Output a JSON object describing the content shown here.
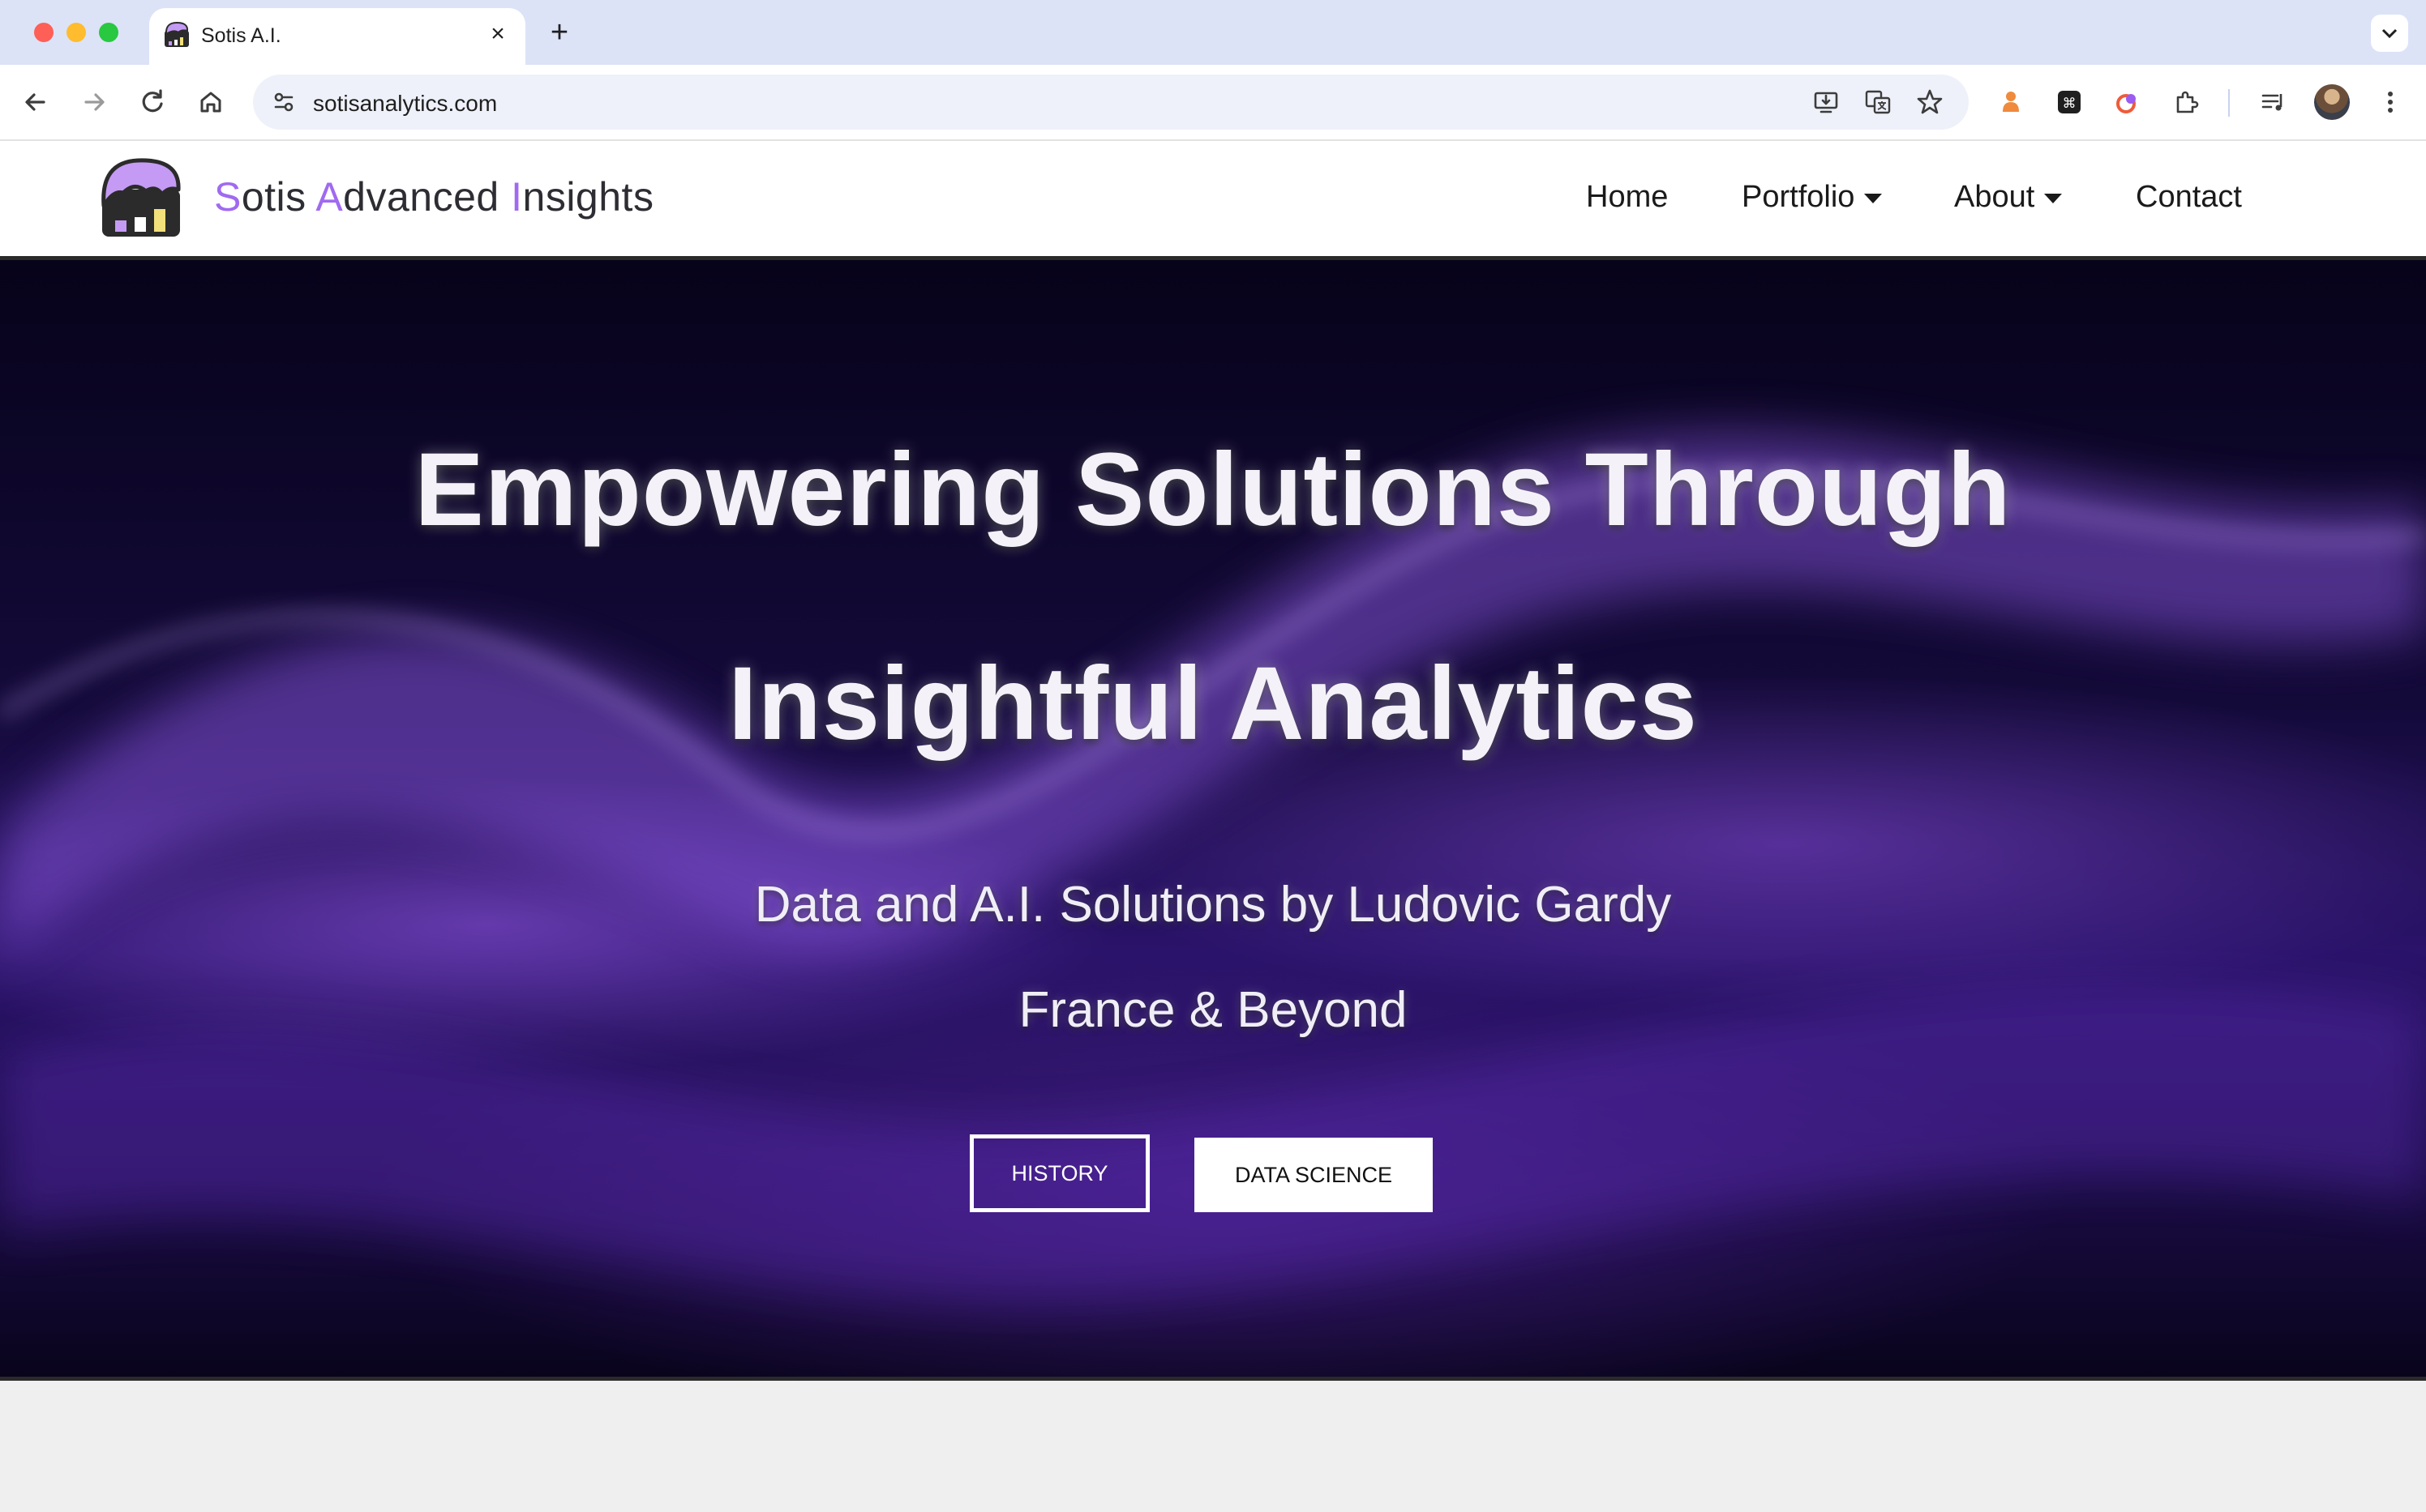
{
  "browser": {
    "tab": {
      "title": "Sotis A.I.",
      "favicon": "site-logo-icon"
    },
    "new_tab_symbol": "+",
    "close_symbol": "×",
    "url": "sotisanalytics.com",
    "toolbar_icons": [
      "back-icon",
      "forward-icon",
      "reload-icon",
      "home-icon",
      "site-settings-icon",
      "install-app-icon",
      "translate-icon",
      "bookmark-star-icon",
      "extension-1-icon",
      "extension-2-icon",
      "extension-3-icon",
      "extensions-puzzle-icon",
      "media-controls-icon",
      "profile-avatar",
      "chrome-menu-icon"
    ]
  },
  "site": {
    "brand": {
      "s": "S",
      "rest1": "otis ",
      "a": "A",
      "rest2": "dvanced ",
      "i": "I",
      "rest3": "nsights"
    },
    "accent_color": "#a06af0",
    "nav": {
      "home": "Home",
      "portfolio": "Portfolio",
      "about": "About",
      "contact": "Contact"
    }
  },
  "hero": {
    "title_line1": "Empowering Solutions Through",
    "title_line2": "Insightful Analytics",
    "subtitle_line1": "Data and A.I. Solutions by Ludovic Gardy",
    "subtitle_line2": "France & Beyond",
    "buttons": {
      "history": "HISTORY",
      "data_science": "DATA SCIENCE"
    }
  }
}
